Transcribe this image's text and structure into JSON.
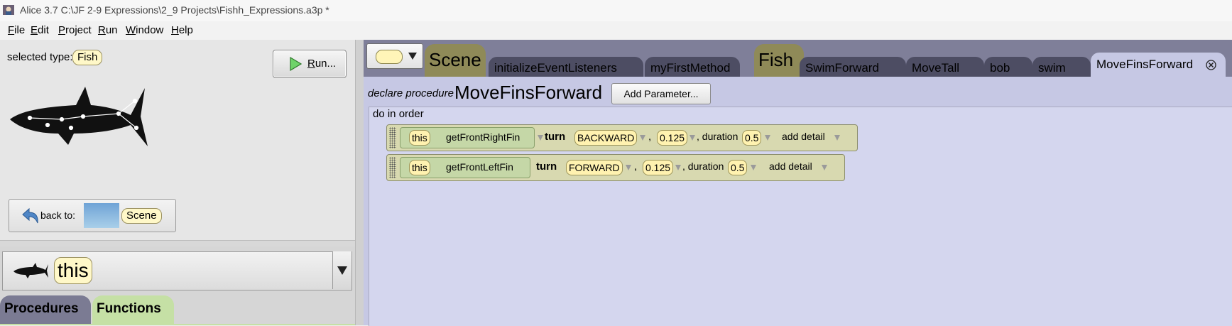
{
  "window": {
    "title": "Alice 3.7 C:\\JF 2-9 Expressions\\2_9 Projects\\Fishh_Expressions.a3p *"
  },
  "menu": {
    "file": {
      "mnemonic": "F",
      "rest": "ile"
    },
    "edit": {
      "mnemonic": "E",
      "rest": "dit"
    },
    "project": {
      "mnemonic": "P",
      "rest": "roject"
    },
    "run": {
      "mnemonic": "R",
      "rest": "un"
    },
    "window": {
      "mnemonic": "W",
      "rest": "indow"
    },
    "help": {
      "mnemonic": "H",
      "rest": "elp"
    }
  },
  "left": {
    "selected_type_label": "selected type:",
    "selected_type": "Fish",
    "run_button": {
      "mnemonic": "R",
      "rest": "un..."
    },
    "back_to_label": "back to:",
    "back_to_target": "Scene",
    "combo_value": "this",
    "tabs": {
      "procedures": "Procedures",
      "functions": "Functions"
    }
  },
  "tabs": {
    "scene_type": "Scene",
    "scene_methods": [
      "initializeEventListeners",
      "myFirstMethod"
    ],
    "fish_type": "Fish",
    "fish_methods": [
      "SwimForward",
      "MoveTall",
      "bob",
      "swim"
    ],
    "active": "MoveFinsForward"
  },
  "editor": {
    "declare_label": "declare procedure",
    "procedure_name": "MoveFinsForward",
    "add_parameter_label": "Add Parameter...",
    "do_in_order_label": "do in order",
    "statements": [
      {
        "target": "this",
        "getter": "getFrontRightFin",
        "method": "turn",
        "direction": "BACKWARD",
        "amount": "0.125",
        "duration_label": ", duration",
        "duration": "0.5",
        "detail": "add detail"
      },
      {
        "target": "this",
        "getter": "getFrontLeftFin",
        "method": "turn",
        "direction": "FORWARD",
        "amount": "0.125",
        "duration_label": ", duration",
        "duration": "0.5",
        "detail": "add detail"
      }
    ]
  },
  "colors": {
    "accent_code": "#c6c8e4",
    "tab_strip": "#7f7f99",
    "type_tab": "#8f8a58"
  }
}
